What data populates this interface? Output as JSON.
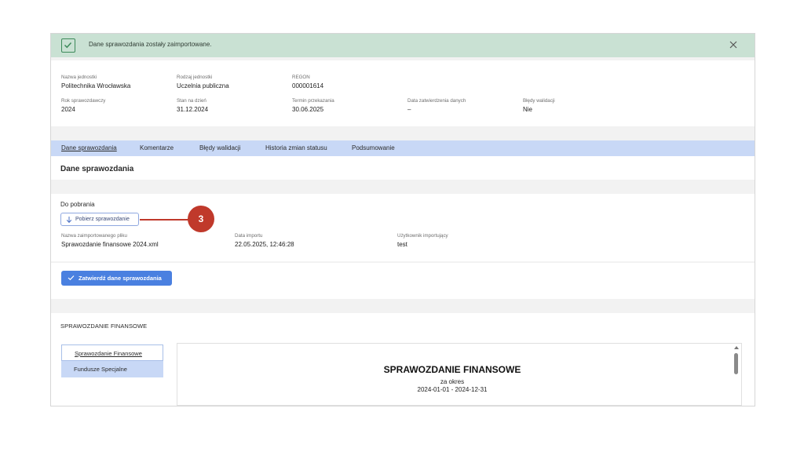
{
  "notification": {
    "text": "Dane sprawozdania zostały zaimportowane."
  },
  "info": {
    "row1": [
      {
        "label": "Nazwa jednostki",
        "value": "Politechnika Wrocławska"
      },
      {
        "label": "Rodzaj jednostki",
        "value": "Uczelnia publiczna"
      },
      {
        "label": "REGON",
        "value": "000001614"
      }
    ],
    "row2": [
      {
        "label": "Rok sprawozdawczy",
        "value": "2024"
      },
      {
        "label": "Stan na dzień",
        "value": "31.12.2024"
      },
      {
        "label": "Termin przekazania",
        "value": "30.06.2025"
      },
      {
        "label": "Data zatwierdzenia danych",
        "value": "–"
      },
      {
        "label": "Błędy walidacji",
        "value": "Nie"
      }
    ]
  },
  "tabs": [
    {
      "label": "Dane sprawozdania",
      "active": true
    },
    {
      "label": "Komentarze"
    },
    {
      "label": "Błędy walidacji"
    },
    {
      "label": "Historia zmian statusu"
    },
    {
      "label": "Podsumowanie"
    }
  ],
  "section_title": "Dane sprawozdania",
  "download": {
    "heading": "Do pobrania",
    "button_label": "Pobierz sprawozdanie",
    "fields": [
      {
        "label": "Nazwa zaimportowanego pliku",
        "value": "Sprawozdanie finansowe 2024.xml"
      },
      {
        "label": "Data importu",
        "value": "22.05.2025, 12:46:28"
      },
      {
        "label": "Użytkownik importujący",
        "value": "test"
      }
    ]
  },
  "callout": {
    "number": "3",
    "color": "#c0392b"
  },
  "approve_button": "Zatwierdź dane sprawozdania",
  "financial": {
    "heading": "SPRAWOZDANIE FINANSOWE",
    "nav": [
      {
        "label": "Sprawozdanie Finansowe",
        "active": true
      },
      {
        "label": "Fundusze Specjalne"
      }
    ],
    "document": {
      "title": "SPRAWOZDANIE FINANSOWE",
      "subtitle": "za okres",
      "range": "2024-01-01 - 2024-12-31"
    }
  },
  "colors": {
    "notification_bg": "#c9e1d3",
    "tab_bar_bg": "#c8d8f6",
    "primary_button": "#4a80e0",
    "accent_red": "#c0392b"
  },
  "icons": [
    "check-icon",
    "close-icon",
    "download-arrow-icon",
    "checkmark-icon",
    "scroll-up-icon"
  ]
}
